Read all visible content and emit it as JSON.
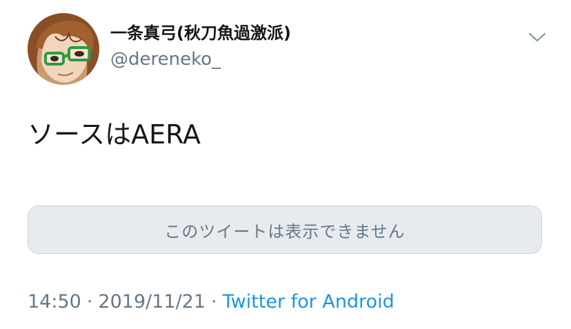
{
  "tweet": {
    "author": {
      "display_name": "一条真弓(秋刀魚過激派)",
      "handle": "@dereneko_"
    },
    "text": "ソースはAERA",
    "quoted_unavailable_text": "このツイートは表示できません",
    "timestamp": {
      "time": "14:50",
      "separator": "·",
      "date": "2019/11/21",
      "source": "Twitter for Android"
    },
    "menu_icon": "chevron-down-icon"
  },
  "colors": {
    "text_primary": "#14171a",
    "text_secondary": "#657786",
    "link": "#1b95e0",
    "card_background": "#e7ebee"
  }
}
